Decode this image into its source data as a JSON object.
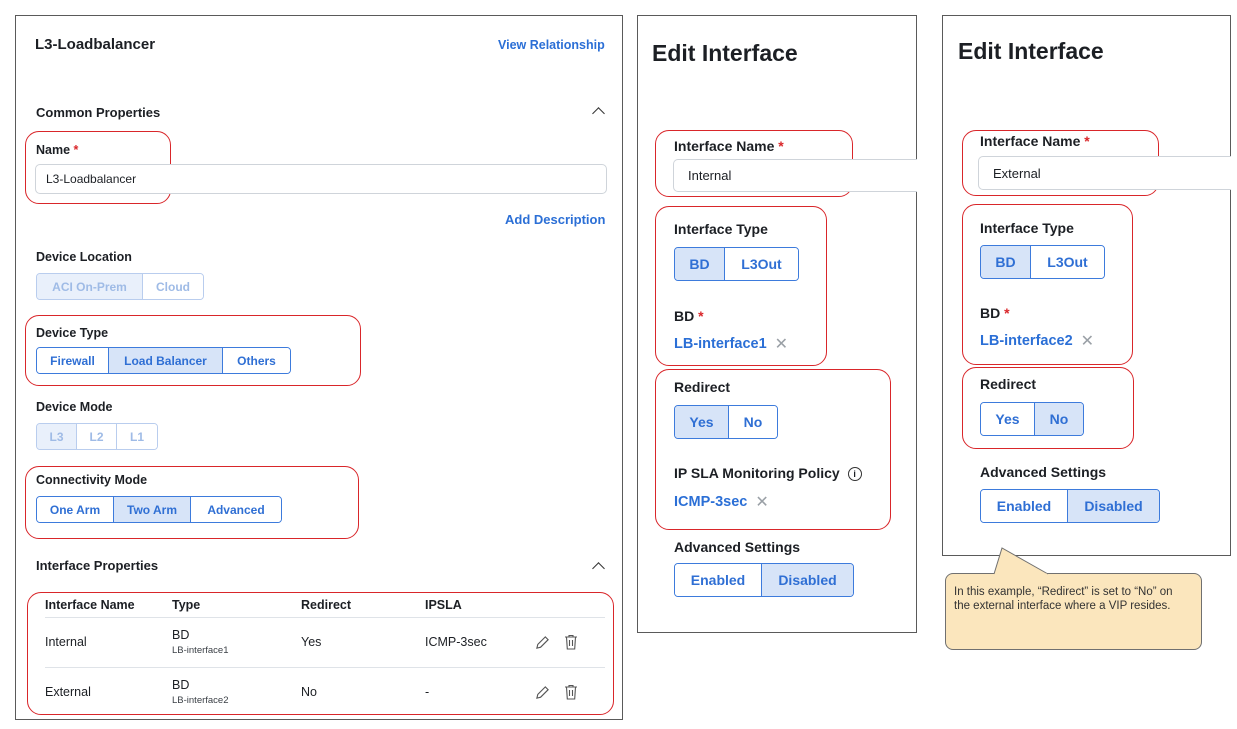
{
  "device_panel": {
    "title": "L3-Loadbalancer",
    "view_relationship": "View Relationship",
    "common_properties": "Common Properties",
    "name_label": "Name",
    "required_mark": "*",
    "name_value": "L3-Loadbalancer",
    "add_description": "Add Description",
    "device_location": {
      "label": "Device Location",
      "options": [
        "ACI On-Prem",
        "Cloud"
      ],
      "selected": "ACI On-Prem"
    },
    "device_type": {
      "label": "Device Type",
      "options": [
        "Firewall",
        "Load Balancer",
        "Others"
      ],
      "selected": "Load Balancer"
    },
    "device_mode": {
      "label": "Device Mode",
      "options": [
        "L3",
        "L2",
        "L1"
      ],
      "selected": "L3"
    },
    "connectivity_mode": {
      "label": "Connectivity Mode",
      "options": [
        "One Arm",
        "Two Arm",
        "Advanced"
      ],
      "selected": "Two Arm"
    },
    "interface_properties": "Interface Properties",
    "table": {
      "headers": [
        "Interface Name",
        "Type",
        "Redirect",
        "IPSLA"
      ],
      "rows": [
        {
          "name": "Internal",
          "type": "BD",
          "type_sub": "LB-interface1",
          "redirect": "Yes",
          "ipsla": "ICMP-3sec"
        },
        {
          "name": "External",
          "type": "BD",
          "type_sub": "LB-interface2",
          "redirect": "No",
          "ipsla": "-"
        }
      ]
    }
  },
  "edit_internal": {
    "title": "Edit Interface",
    "interface_name_label": "Interface Name",
    "required_mark": "*",
    "interface_name_value": "Internal",
    "interface_type_label": "Interface Type",
    "interface_type_options": [
      "BD",
      "L3Out"
    ],
    "interface_type_selected": "BD",
    "bd_label": "BD",
    "bd_value": "LB-interface1",
    "redirect_label": "Redirect",
    "redirect_options": [
      "Yes",
      "No"
    ],
    "redirect_selected": "Yes",
    "ipsla_label": "IP SLA Monitoring Policy",
    "ipsla_value": "ICMP-3sec",
    "advanced_label": "Advanced Settings",
    "advanced_options": [
      "Enabled",
      "Disabled"
    ],
    "advanced_selected": "Disabled"
  },
  "edit_external": {
    "title": "Edit Interface",
    "interface_name_label": "Interface Name",
    "required_mark": "*",
    "interface_name_value": "External",
    "interface_type_label": "Interface Type",
    "interface_type_options": [
      "BD",
      "L3Out"
    ],
    "interface_type_selected": "BD",
    "bd_label": "BD",
    "bd_value": "LB-interface2",
    "redirect_label": "Redirect",
    "redirect_options": [
      "Yes",
      "No"
    ],
    "redirect_selected": "No",
    "advanced_label": "Advanced Settings",
    "advanced_options": [
      "Enabled",
      "Disabled"
    ],
    "advanced_selected": "Disabled"
  },
  "callout": {
    "text": "In this example, “Redirect” is set to “No” on the external interface where a VIP resides."
  },
  "colors": {
    "accent": "#2b6fd6",
    "highlight_box": "#d9262a",
    "selected_bg": "#d7e4f8",
    "callout_bg": "#fbe6bd"
  },
  "icons": [
    "chevron-up-icon",
    "pencil-icon",
    "trash-icon",
    "close-icon",
    "info-icon"
  ]
}
